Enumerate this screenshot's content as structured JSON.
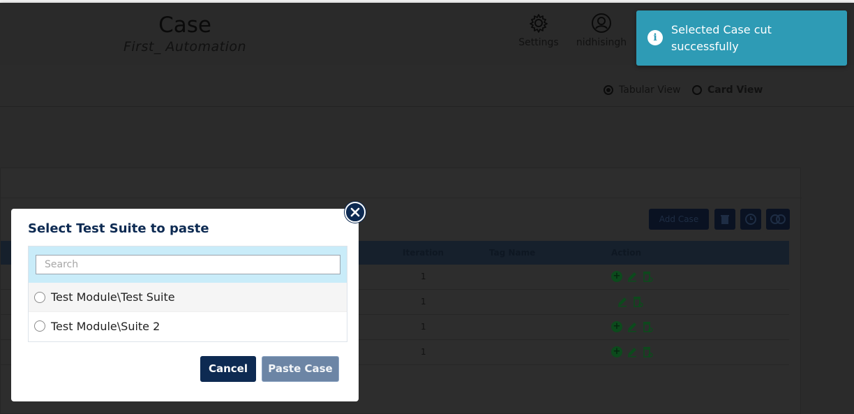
{
  "header": {
    "title": "Case",
    "subtitle": "First_ Automation",
    "settings_label": "Settings",
    "user_label": "nidhisingh"
  },
  "view_toggle": {
    "tabular_label": "Tabular View",
    "card_label": "Card View",
    "selected": "Tabular View"
  },
  "toolbar": {
    "add_case_label": "Add Case"
  },
  "table": {
    "columns": [
      "Iteration",
      "Tag Name",
      "Action"
    ],
    "rows": [
      {
        "iteration": "1",
        "tag_name": "",
        "actions": [
          "add-icon",
          "edit-icon",
          "delete-icon"
        ]
      },
      {
        "iteration": "1",
        "tag_name": "",
        "actions": [
          "edit-icon",
          "delete-icon"
        ]
      },
      {
        "iteration": "1",
        "tag_name": "",
        "actions": [
          "add-icon",
          "edit-icon",
          "delete-icon"
        ]
      },
      {
        "iteration": "1",
        "tag_name": "",
        "actions": [
          "add-icon",
          "edit-icon",
          "delete-icon"
        ]
      }
    ]
  },
  "modal": {
    "title": "Select Test Suite to paste",
    "search_placeholder": "Search",
    "search_value": "",
    "suites": [
      {
        "label": "Test Module\\Test Suite"
      },
      {
        "label": "Test Module\\Suite 2"
      }
    ],
    "cancel_label": "Cancel",
    "paste_label": "Paste Case"
  },
  "toast": {
    "message": "Selected Case cut successfully",
    "color": "#2e9bb5",
    "icon": "info-icon"
  },
  "colors": {
    "primary": "#0d2a52",
    "search_band": "#c9ecf9",
    "paste_button": "#6c85a5"
  }
}
